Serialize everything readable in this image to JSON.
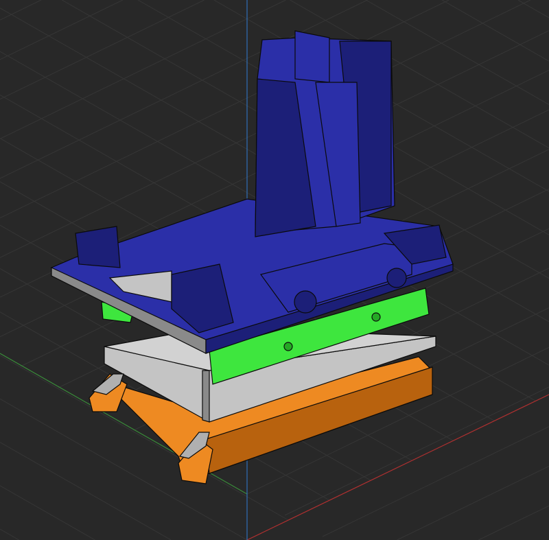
{
  "colors": {
    "background": "#282828",
    "grid": "#363636",
    "axis_vertical": "#2f6fb8",
    "axis_x": "#b03030",
    "axis_y": "#3a8a3a",
    "blue_part": "#2b2fa8",
    "blue_part_dark": "#1c1f78",
    "green_part": "#3ee63e",
    "green_part_dark": "#25a825",
    "gray_plate": "#c4c4c4",
    "gray_plate_dark": "#8a8a8a",
    "orange_part": "#ee8a22",
    "orange_part_dark": "#b8620e",
    "edge": "#0a0a0a"
  }
}
